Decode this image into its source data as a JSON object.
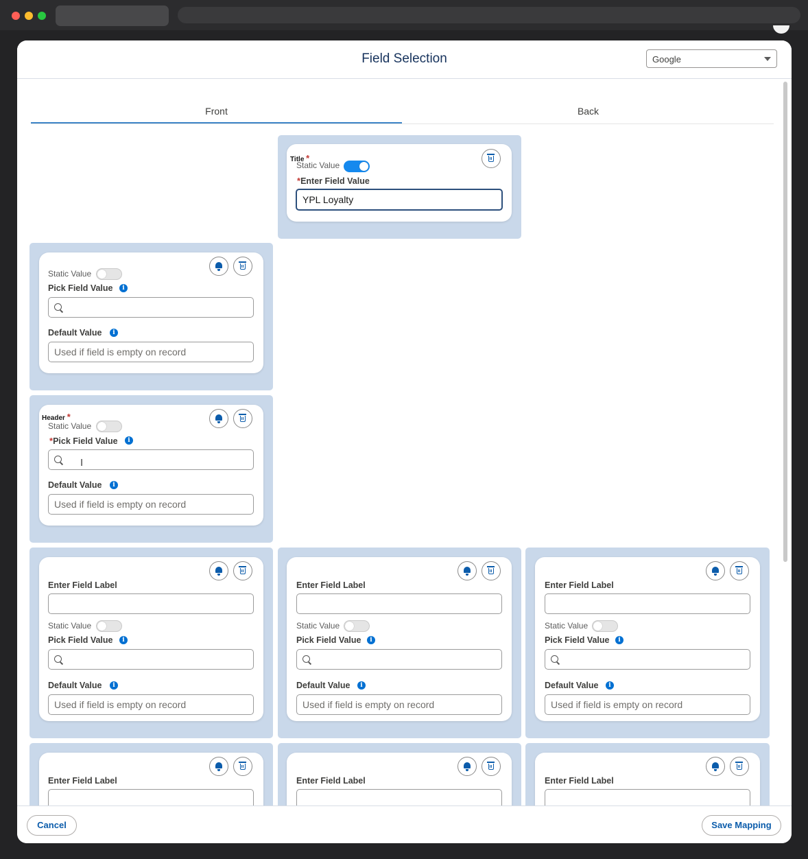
{
  "modal": {
    "title": "Field Selection",
    "brand_select": {
      "value": "Google",
      "caret": "chevron-down-icon"
    }
  },
  "tabs": [
    {
      "label": "Front",
      "active": true
    },
    {
      "label": "Back",
      "active": false
    }
  ],
  "labels": {
    "static_value": "Static Value",
    "pick_field_value": "Pick Field Value",
    "default_value": "Default Value",
    "enter_field_label": "Enter Field Label",
    "enter_field_value": "Enter Field Value",
    "required_mark": "*",
    "info_glyph": "i"
  },
  "placeholders": {
    "default_value": "Used if field is empty on record"
  },
  "title_card": {
    "section": "Title",
    "static_value_on": true,
    "field_value": "YPL Loyalty"
  },
  "header_card": {
    "section": "Header",
    "static_value_on": false
  },
  "footer": {
    "cancel_label": "Cancel",
    "save_label": "Save Mapping"
  },
  "colors": {
    "accent": "#0b5cab",
    "panel": "#c9d8ea",
    "toggle_on": "#1589ee",
    "required": "#c23934"
  }
}
